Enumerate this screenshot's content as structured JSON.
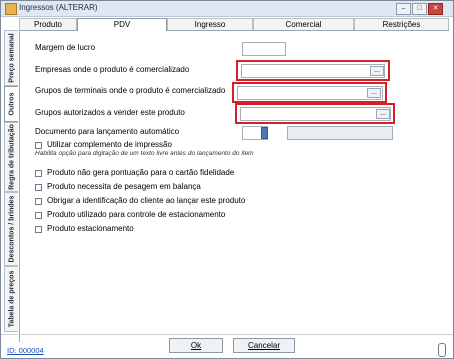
{
  "window": {
    "title": "Ingressos (ALTERAR)"
  },
  "tabs": [
    "Produto",
    "PDV",
    "Ingresso",
    "Comercial",
    "Restrições"
  ],
  "active_tab": "PDV",
  "side_tabs": [
    "Preço semanal",
    "Outros",
    "Regra de tributação",
    "Descontos / brindes",
    "Tabela de preços"
  ],
  "active_side_tab": "Outros",
  "fields": {
    "margem_label": "Margem de lucro",
    "empresas_label": "Empresas onde o produto é comercializado",
    "grupos_terminais_label": "Grupos de terminais onde o produto é comercializado",
    "grupos_autorizados_label": "Grupos autorizados a vender este produto",
    "documento_label": "Documento para lançamento automático",
    "ellipsis": "..."
  },
  "checkboxes": {
    "complemento": {
      "label": "Utilizar complemento de impressão",
      "hint": "Habilita opção para digitação de um texto livre antes do lançamento do item"
    },
    "others": [
      "Produto não gera pontuação para o cartão fidelidade",
      "Produto necessita de pesagem em balança",
      "Obrigar a identificação do cliente ao lançar este produto",
      "Produto utilizado para controle de estacionamento",
      "Produto estacionamento"
    ]
  },
  "footer": {
    "id_text": "ID: 000004",
    "ok_label": "Ok",
    "cancel_label": "Cancelar"
  },
  "colors": {
    "highlight": "#d4202a",
    "link": "#1a4fb3"
  }
}
